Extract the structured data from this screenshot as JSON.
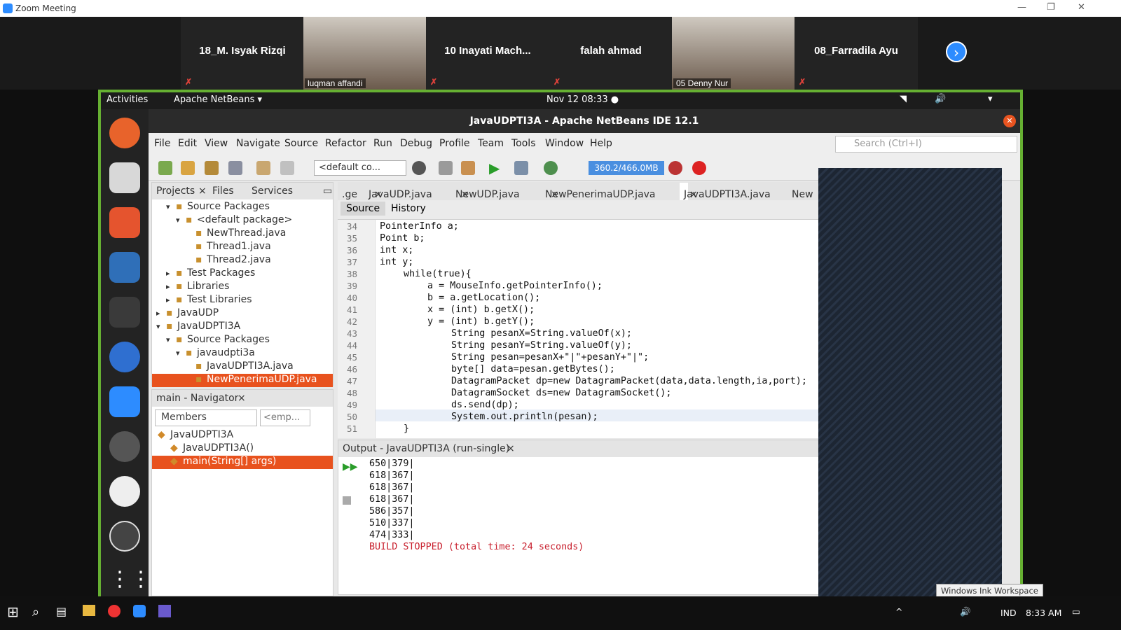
{
  "zoom": {
    "title": "Zoom Meeting"
  },
  "participants": [
    {
      "name": "18_M. Isyak Rizqi",
      "muted": true
    },
    {
      "name": "luqman affandi",
      "video": true
    },
    {
      "name": "10  Inayati  Mach...",
      "muted": true
    },
    {
      "name": "falah ahmad",
      "muted": true
    },
    {
      "name": "05 Denny Nur",
      "video": true
    },
    {
      "name": "08_Farradila Ayu",
      "muted": true
    }
  ],
  "gnome": {
    "activities": "Activities",
    "app": "Apache NetBeans ▾",
    "clock": "Nov 12  08:33  ●"
  },
  "netbeans": {
    "title": "JavaUDPTI3A - Apache NetBeans IDE 12.1",
    "menu": [
      "File",
      "Edit",
      "View",
      "Navigate",
      "Source",
      "Refactor",
      "Run",
      "Debug",
      "Profile",
      "Team",
      "Tools",
      "Window",
      "Help"
    ],
    "search_placeholder": "Search (Ctrl+I)",
    "config": "<default co...",
    "memory": "360.2/466.0MB",
    "left_tabs": [
      "Projects",
      "Files",
      "Services"
    ],
    "tree": [
      {
        "label": "Source Packages",
        "indent": 1,
        "arrow": "▾"
      },
      {
        "label": "<default package>",
        "indent": 2,
        "arrow": "▾"
      },
      {
        "label": "NewThread.java",
        "indent": 3,
        "arrow": ""
      },
      {
        "label": "Thread1.java",
        "indent": 3,
        "arrow": ""
      },
      {
        "label": "Thread2.java",
        "indent": 3,
        "arrow": ""
      },
      {
        "label": "Test Packages",
        "indent": 1,
        "arrow": "▸"
      },
      {
        "label": "Libraries",
        "indent": 1,
        "arrow": "▸"
      },
      {
        "label": "Test Libraries",
        "indent": 1,
        "arrow": "▸"
      },
      {
        "label": "JavaUDP",
        "indent": 0,
        "arrow": "▸"
      },
      {
        "label": "JavaUDPTI3A",
        "indent": 0,
        "arrow": "▾"
      },
      {
        "label": "Source Packages",
        "indent": 1,
        "arrow": "▾"
      },
      {
        "label": "javaudpti3a",
        "indent": 2,
        "arrow": "▾"
      },
      {
        "label": "JavaUDPTI3A.java",
        "indent": 3,
        "arrow": ""
      },
      {
        "label": "NewPenerimaUDP.java",
        "indent": 3,
        "arrow": "",
        "selected": true
      }
    ],
    "navigator": {
      "title": "main - Navigator",
      "filter": "Members",
      "empty": "<emp...",
      "items": [
        {
          "label": "JavaUDPTI3A",
          "indent": 0
        },
        {
          "label": "JavaUDPTI3A()",
          "indent": 1
        },
        {
          "label": "main(String[] args)",
          "indent": 1,
          "selected": true
        }
      ]
    },
    "editor_tabs": [
      ".ge",
      "JavaUDP.java",
      "NewUDP.java",
      "NewPenerimaUDP.java",
      "JavaUDPTI3A.java",
      "New"
    ],
    "editor_bar": {
      "source": "Source",
      "history": "History"
    },
    "code": [
      {
        "n": "34",
        "t": "PointerInfo a;",
        "i": 0
      },
      {
        "n": "35",
        "t": "Point b;",
        "i": 0
      },
      {
        "n": "36",
        "t": "int x;",
        "i": 0
      },
      {
        "n": "37",
        "t": "int y;",
        "i": 0
      },
      {
        "n": "38",
        "t": "while(true){",
        "i": 1
      },
      {
        "n": "39",
        "t": "a = MouseInfo.getPointerInfo();",
        "i": 2
      },
      {
        "n": "40",
        "t": "b = a.getLocation();",
        "i": 2
      },
      {
        "n": "41",
        "t": "x = (int) b.getX();",
        "i": 2
      },
      {
        "n": "42",
        "t": "y = (int) b.getY();",
        "i": 2
      },
      {
        "n": "43",
        "t": "String pesanX=String.valueOf(x);",
        "i": 3
      },
      {
        "n": "44",
        "t": "String pesanY=String.valueOf(y);",
        "i": 3
      },
      {
        "n": "45",
        "t": "String pesan=pesanX+\"|\"+pesanY+\"|\";",
        "i": 3
      },
      {
        "n": "46",
        "t": "byte[] data=pesan.getBytes();",
        "i": 3
      },
      {
        "n": "47",
        "t": "DatagramPacket dp=new DatagramPacket(data,data.length,ia,port);",
        "i": 3
      },
      {
        "n": "48",
        "t": "DatagramSocket ds=new DatagramSocket();",
        "i": 3
      },
      {
        "n": "49",
        "t": "ds.send(dp);",
        "i": 3
      },
      {
        "n": "50",
        "t": "System.out.println(pesan);",
        "i": 3
      },
      {
        "n": "51",
        "t": "}",
        "i": 1
      }
    ],
    "output": {
      "title": "Output - JavaUDPTI3A (run-single)",
      "lines": [
        "650|379|",
        "618|367|",
        "618|367|",
        "618|367|",
        "586|357|",
        "510|337|",
        "474|333|"
      ],
      "status": "BUILD STOPPED (total time: 24 seconds)"
    }
  },
  "ink_tooltip": "Windows Ink Workspace",
  "taskbar": {
    "lang": "IND",
    "time": "8:33 AM"
  }
}
